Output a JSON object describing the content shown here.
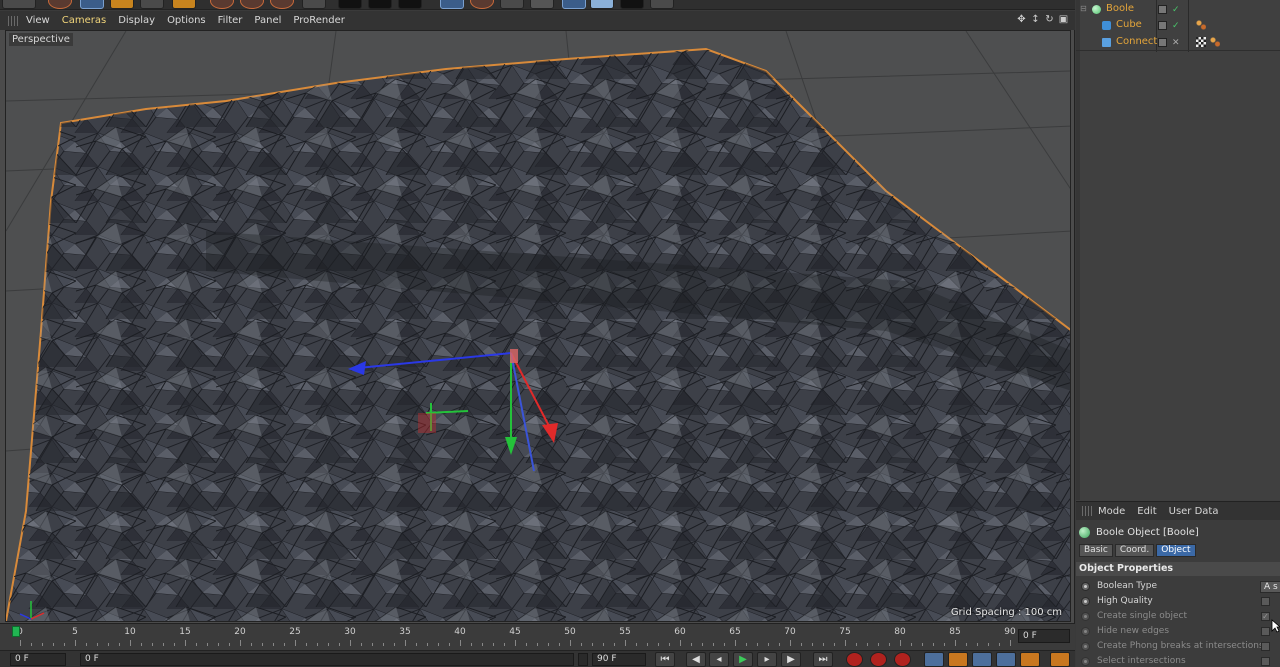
{
  "viewport": {
    "menu": [
      "View",
      "Cameras",
      "Display",
      "Options",
      "Filter",
      "Panel",
      "ProRender"
    ],
    "active_menu": "Cameras",
    "camera_label": "Perspective",
    "grid_spacing": "Grid Spacing : 100 cm"
  },
  "timeline": {
    "ticks": [
      "0",
      "5",
      "10",
      "15",
      "20",
      "25",
      "30",
      "35",
      "40",
      "45",
      "50",
      "55",
      "60",
      "65",
      "70",
      "75",
      "80",
      "85",
      "90"
    ],
    "end_field": "0 F",
    "current_frame": 0
  },
  "transport": {
    "current": "0 F",
    "start": "0 F",
    "min_field": "90 F",
    "max_field": "90 F",
    "buttons": {
      "goto_start": "⏮",
      "prev_key": "◀",
      "prev_frame": "◂",
      "play": "▶",
      "next_frame": "▸",
      "next_key": "▶",
      "goto_end": "⏭"
    }
  },
  "object_manager": {
    "objects": [
      {
        "name": "Boole",
        "icon_color": "#4ec36b",
        "checked": true
      },
      {
        "name": "Cube",
        "icon_color": "#3f8fd8",
        "checked": true
      },
      {
        "name": "Connect",
        "icon_color": "#5aa0e0",
        "checked": false
      }
    ]
  },
  "attribute_manager": {
    "menu": [
      "Mode",
      "Edit",
      "User Data"
    ],
    "title": "Boole Object [Boole]",
    "tabs": [
      "Basic",
      "Coord.",
      "Object"
    ],
    "active_tab": "Object",
    "section": "Object Properties",
    "properties": [
      {
        "label": "Boolean Type",
        "control": "dropdown",
        "value": "A s",
        "enabled": true
      },
      {
        "label": "High Quality",
        "control": "checkbox",
        "value": "",
        "enabled": true
      },
      {
        "label": "Create single object",
        "control": "checkbox",
        "value": "✓",
        "enabled": false
      },
      {
        "label": "Hide new edges",
        "control": "checkbox",
        "value": "",
        "enabled": false
      },
      {
        "label": "Create Phong breaks at intersections",
        "control": "checkbox",
        "value": "",
        "enabled": false
      },
      {
        "label": "Select intersections",
        "control": "checkbox",
        "value": "",
        "enabled": false
      }
    ]
  },
  "colors": {
    "accent": "#3b69a6",
    "object_name": "#e4a53a",
    "selection_outline": "#d88a3a",
    "axis_x": "#e12a2a",
    "axis_y": "#24c23a",
    "axis_z": "#2a38e6"
  }
}
